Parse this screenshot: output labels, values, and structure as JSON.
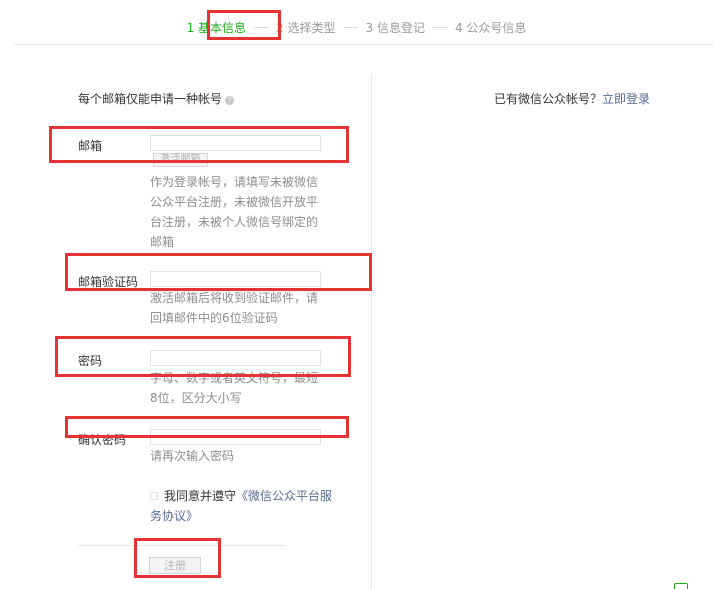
{
  "steps": [
    {
      "label": "1 基本信息",
      "active": true
    },
    {
      "label": "2 选择类型",
      "active": false
    },
    {
      "label": "3 信息登记",
      "active": false
    },
    {
      "label": "4 公众号信息",
      "active": false
    }
  ],
  "left_tip": "每个邮箱仅能申请一种帐号",
  "right_tip": {
    "text": "已有微信公众帐号？",
    "link": "立即登录"
  },
  "form": {
    "email": {
      "label": "邮箱",
      "value": "",
      "activate_button": "激活邮箱",
      "desc": "作为登录帐号，请填写未被微信公众平台注册，未被微信开放平台注册，未被个人微信号绑定的邮箱"
    },
    "email_code": {
      "label": "邮箱验证码",
      "value": "",
      "desc": "激活邮箱后将收到验证邮件，请回填邮件中的6位验证码"
    },
    "password": {
      "label": "密码",
      "value": "",
      "desc": "字母、数字或者英文符号，最短8位，区分大小写"
    },
    "confirm_password": {
      "label": "确认密码",
      "value": "",
      "desc": "请再次输入密码"
    },
    "agreement": {
      "prefix": "我同意并遵守",
      "link": "《微信公众平台服务协议》"
    },
    "submit_label": "注册"
  },
  "colors": {
    "accent": "#1aad19",
    "link": "#576b95",
    "annotation": "#e53333"
  }
}
